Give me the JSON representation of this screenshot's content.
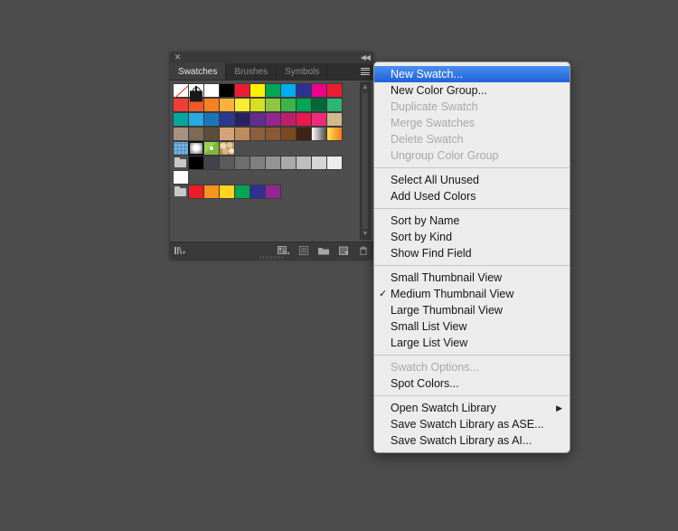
{
  "app": {
    "background_color": "#4c4c4c"
  },
  "panel": {
    "title": "Swatches",
    "close_glyph": "✕",
    "collapse_glyph": "◀◀",
    "tabs": [
      {
        "label": "Swatches",
        "active": true
      },
      {
        "label": "Brushes",
        "active": false
      },
      {
        "label": "Symbols",
        "active": false
      }
    ],
    "menu_button_name": "panel-menu-button",
    "scrollbar": {
      "up_glyph": "▲",
      "down_glyph": "▼"
    },
    "footer_buttons": [
      {
        "name": "swatch-libraries-menu-icon",
        "label": "Swatch Libraries menu"
      },
      {
        "name": "show-swatch-kinds-menu-icon",
        "label": "Show Swatch Kinds menu"
      },
      {
        "name": "swatch-options-icon",
        "label": "Swatch Options"
      },
      {
        "name": "new-color-group-icon",
        "label": "New Color Group"
      },
      {
        "name": "new-swatch-icon",
        "label": "New Swatch"
      },
      {
        "name": "delete-swatch-icon",
        "label": "Delete Swatch"
      }
    ],
    "swatch_rows": [
      {
        "type": "colors",
        "cells": [
          {
            "kind": "none"
          },
          {
            "kind": "registration"
          },
          {
            "color": "#ffffff"
          },
          {
            "color": "#000000"
          },
          {
            "color": "#ed1c32"
          },
          {
            "color": "#fff200"
          },
          {
            "color": "#00a651"
          },
          {
            "color": "#00adee"
          },
          {
            "color": "#2e3192"
          },
          {
            "color": "#ec008b"
          },
          {
            "color": "#ed1c32"
          }
        ]
      },
      {
        "type": "colors",
        "cells": [
          {
            "color": "#ef3e36"
          },
          {
            "color": "#f05a28"
          },
          {
            "color": "#f58220"
          },
          {
            "color": "#fbb040"
          },
          {
            "color": "#f9ed32"
          },
          {
            "color": "#d7df23"
          },
          {
            "color": "#8dc63f"
          },
          {
            "color": "#3bb54a"
          },
          {
            "color": "#00a651"
          },
          {
            "color": "#006838"
          },
          {
            "color": "#2bb673"
          }
        ]
      },
      {
        "type": "colors",
        "cells": [
          {
            "color": "#00a79d"
          },
          {
            "color": "#27aae1"
          },
          {
            "color": "#1c75bc"
          },
          {
            "color": "#2b3990"
          },
          {
            "color": "#262262"
          },
          {
            "color": "#652d90"
          },
          {
            "color": "#92278f"
          },
          {
            "color": "#bf1e6d"
          },
          {
            "color": "#ec1651"
          },
          {
            "color": "#ee2a7b"
          },
          {
            "color": "#d3b88c"
          }
        ]
      },
      {
        "type": "colors",
        "cells": [
          {
            "color": "#a79280"
          },
          {
            "color": "#7c6a55"
          },
          {
            "color": "#5c4c3c"
          },
          {
            "color": "#d5a377"
          },
          {
            "color": "#c08a5a"
          },
          {
            "color": "#8c5f3f"
          },
          {
            "color": "#8a5a33"
          },
          {
            "color": "#7a4a24"
          },
          {
            "color": "#3d2415"
          },
          {
            "gradient": "white-to-black"
          },
          {
            "gradient": "yellow-to-orange"
          }
        ]
      },
      {
        "type": "patterns",
        "cells": [
          {
            "pattern": "grid-blue"
          },
          {
            "pattern": "sphere-ball"
          },
          {
            "pattern": "green-leaf"
          },
          {
            "pattern": "stones"
          }
        ]
      },
      {
        "type": "group-gray",
        "folder": true,
        "cells": [
          {
            "color": "#000000"
          },
          {
            "color": "#3f444c"
          },
          {
            "color": "#5b5b5b"
          },
          {
            "color": "#6e6e6e"
          },
          {
            "color": "#808080"
          },
          {
            "color": "#949494"
          },
          {
            "color": "#a9a9a9"
          },
          {
            "color": "#bfbfbf"
          },
          {
            "color": "#d6d6d6"
          },
          {
            "color": "#ededed"
          }
        ]
      },
      {
        "type": "single",
        "cells": [
          {
            "color": "#ffffff"
          }
        ]
      },
      {
        "type": "group-bright",
        "folder": true,
        "cells": [
          {
            "color": "#ed1c24"
          },
          {
            "color": "#f7941e"
          },
          {
            "color": "#ffd520"
          },
          {
            "color": "#00a651"
          },
          {
            "color": "#2e3192"
          },
          {
            "color": "#92278f"
          }
        ]
      }
    ]
  },
  "context_menu": {
    "sections": [
      {
        "items": [
          {
            "label": "New Swatch...",
            "state": "selected",
            "name": "menu-new-swatch"
          },
          {
            "label": "New Color Group...",
            "state": "normal",
            "name": "menu-new-color-group"
          },
          {
            "label": "Duplicate Swatch",
            "state": "disabled",
            "name": "menu-duplicate-swatch"
          },
          {
            "label": "Merge Swatches",
            "state": "disabled",
            "name": "menu-merge-swatches"
          },
          {
            "label": "Delete Swatch",
            "state": "disabled",
            "name": "menu-delete-swatch"
          },
          {
            "label": "Ungroup Color Group",
            "state": "disabled",
            "name": "menu-ungroup-color-group"
          }
        ]
      },
      {
        "items": [
          {
            "label": "Select All Unused",
            "state": "normal",
            "name": "menu-select-all-unused"
          },
          {
            "label": "Add Used Colors",
            "state": "normal",
            "name": "menu-add-used-colors"
          }
        ]
      },
      {
        "items": [
          {
            "label": "Sort by Name",
            "state": "normal",
            "name": "menu-sort-by-name"
          },
          {
            "label": "Sort by Kind",
            "state": "normal",
            "name": "menu-sort-by-kind"
          },
          {
            "label": "Show Find Field",
            "state": "normal",
            "name": "menu-show-find-field"
          }
        ]
      },
      {
        "items": [
          {
            "label": "Small Thumbnail View",
            "state": "normal",
            "name": "menu-small-thumbnail-view"
          },
          {
            "label": "Medium Thumbnail View",
            "state": "normal",
            "checked": true,
            "name": "menu-medium-thumbnail-view"
          },
          {
            "label": "Large Thumbnail View",
            "state": "normal",
            "name": "menu-large-thumbnail-view"
          },
          {
            "label": "Small List View",
            "state": "normal",
            "name": "menu-small-list-view"
          },
          {
            "label": "Large List View",
            "state": "normal",
            "name": "menu-large-list-view"
          }
        ]
      },
      {
        "items": [
          {
            "label": "Swatch Options...",
            "state": "disabled",
            "name": "menu-swatch-options"
          },
          {
            "label": "Spot Colors...",
            "state": "normal",
            "name": "menu-spot-colors"
          }
        ]
      },
      {
        "items": [
          {
            "label": "Open Swatch Library",
            "state": "normal",
            "submenu": true,
            "name": "menu-open-swatch-library"
          },
          {
            "label": "Save Swatch Library as ASE...",
            "state": "normal",
            "name": "menu-save-swatch-library-ase"
          },
          {
            "label": "Save Swatch Library as AI...",
            "state": "normal",
            "name": "menu-save-swatch-library-ai"
          }
        ]
      }
    ],
    "check_glyph": "✓",
    "submenu_glyph": "▶",
    "highlight_color": "#2f74e0"
  }
}
